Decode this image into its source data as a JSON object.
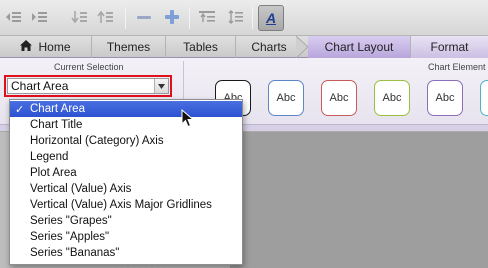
{
  "toolbar": {
    "icons": [
      "decrease-indent-icon",
      "increase-indent-icon",
      "bring-forward-icon",
      "send-backward-icon",
      "minus-icon",
      "plus-icon",
      "align-top-icon",
      "align-center-icon",
      "text-style-icon"
    ],
    "active_icon_glyph": "A"
  },
  "tabs": {
    "home": "Home",
    "themes": "Themes",
    "tables": "Tables",
    "charts": "Charts",
    "chart_layout": "Chart Layout",
    "format": "Format"
  },
  "ribbon": {
    "current_selection_label": "Current Selection",
    "chart_elements_label": "Chart Element",
    "selected_value": "Chart Area",
    "style_thumbs": [
      {
        "label": "Abc",
        "color": "#1a1a1a"
      },
      {
        "label": "Abc",
        "color": "#5b87c9"
      },
      {
        "label": "Abc",
        "color": "#c75b5b"
      },
      {
        "label": "Abc",
        "color": "#9bbf3f"
      },
      {
        "label": "Abc",
        "color": "#8b6fb8"
      },
      {
        "label": "Abc",
        "color": "#4fb3c9"
      }
    ]
  },
  "menu": {
    "items": [
      {
        "label": "Chart Area",
        "selected": true
      },
      {
        "label": "Chart Title",
        "selected": false
      },
      {
        "label": "Horizontal (Category) Axis",
        "selected": false
      },
      {
        "label": "Legend",
        "selected": false
      },
      {
        "label": "Plot Area",
        "selected": false
      },
      {
        "label": "Vertical (Value) Axis",
        "selected": false
      },
      {
        "label": "Vertical (Value) Axis Major Gridlines",
        "selected": false
      },
      {
        "label": "Series \"Grapes\"",
        "selected": false
      },
      {
        "label": "Series \"Apples\"",
        "selected": false
      },
      {
        "label": "Series \"Bananas\"",
        "selected": false
      }
    ],
    "check_glyph": "✓"
  },
  "colors": {
    "highlight_border": "#e0101c",
    "selection_blue": "#2c52d2",
    "ribbon_purple": "#cbbfe3"
  }
}
